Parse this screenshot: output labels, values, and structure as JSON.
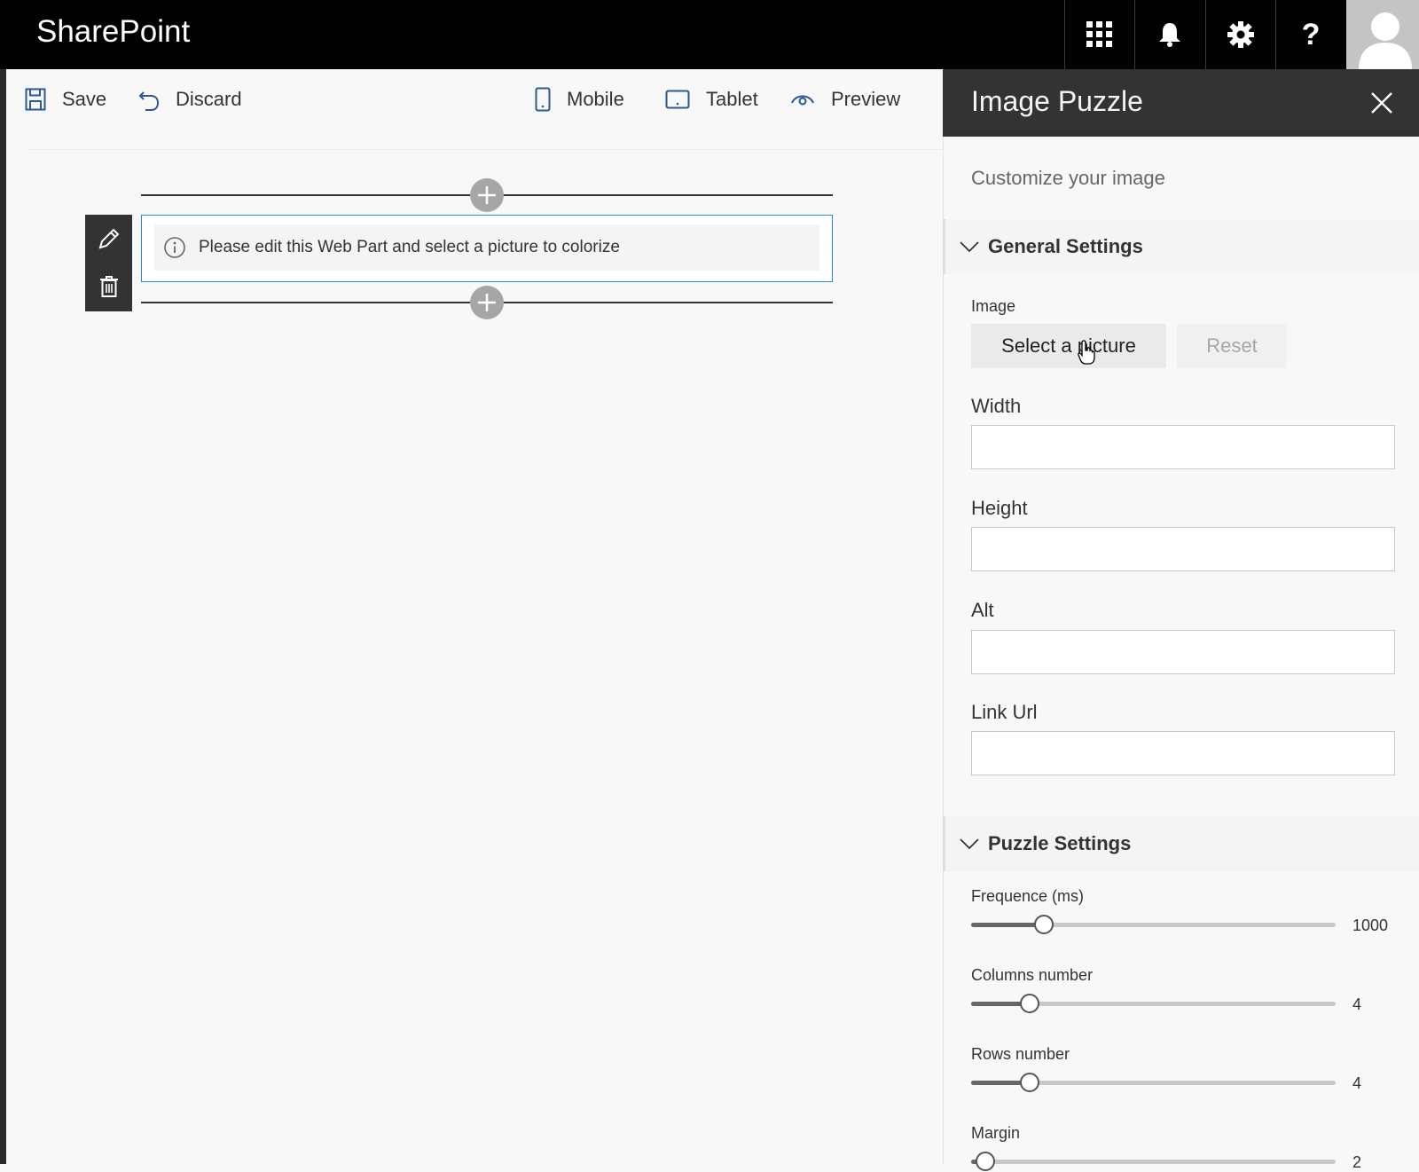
{
  "suitebar": {
    "brand": "SharePoint",
    "icons": [
      "app-launcher-icon",
      "bell-icon",
      "gear-icon",
      "help-icon"
    ],
    "help_glyph": "?"
  },
  "commandbar": {
    "save": "Save",
    "discard": "Discard",
    "mobile": "Mobile",
    "tablet": "Tablet",
    "preview": "Preview"
  },
  "canvas": {
    "placeholder_message": "Please edit this Web Part and select a picture to colorize"
  },
  "pane": {
    "title": "Image Puzzle",
    "description": "Customize your image",
    "general": {
      "heading": "General Settings",
      "image_label": "Image",
      "select_button": "Select a picture",
      "reset_button": "Reset",
      "width_label": "Width",
      "width_value": "",
      "height_label": "Height",
      "height_value": "",
      "alt_label": "Alt",
      "alt_value": "",
      "link_label": "Link Url",
      "link_value": ""
    },
    "puzzle": {
      "heading": "Puzzle Settings",
      "sliders": [
        {
          "label": "Frequence (ms)",
          "value": "1000",
          "fraction": 0.2
        },
        {
          "label": "Columns number",
          "value": "4",
          "fraction": 0.16
        },
        {
          "label": "Rows number",
          "value": "4",
          "fraction": 0.16
        },
        {
          "label": "Margin",
          "value": "2",
          "fraction": 0.04
        }
      ]
    }
  },
  "colors": {
    "suitebar_bg": "#000000",
    "pane_header_bg": "#333333",
    "accent_border": "#2b88d8",
    "canvas_bg": "#f8f8f8"
  }
}
